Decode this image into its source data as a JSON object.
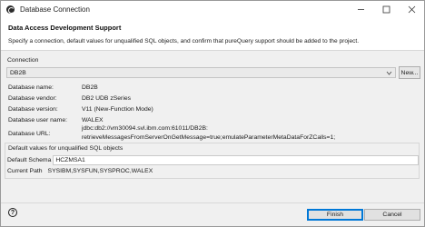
{
  "window": {
    "title": "Database Connection",
    "controls": [
      "minimize-icon",
      "maximize-icon",
      "close-icon"
    ]
  },
  "header": {
    "title": "Data Access Development Support",
    "description": "Specify a connection, default values for unqualified SQL objects, and confirm that pureQuery support should be added to the project."
  },
  "connection": {
    "label": "Connection",
    "selected": "DB2B",
    "new_label": "New..."
  },
  "details": [
    {
      "label": "Database name:",
      "value": "DB2B"
    },
    {
      "label": "Database vendor:",
      "value": "DB2 UDB zSeries"
    },
    {
      "label": "Database version:",
      "value": "V11 (New-Function Mode)"
    },
    {
      "label": "Database user name:",
      "value": "WALEX"
    },
    {
      "label": "Database URL:",
      "value": "jdbc:db2://vm30094.svl.ibm.com:61011/DB2B:",
      "value2": "retrieveMessagesFromServerOnGetMessage=true;emulateParameterMetaDataForZCalls=1;"
    }
  ],
  "defaults": {
    "group_title": "Default values for unqualified SQL objects",
    "schema_label": "Default Schema",
    "schema_value": "HCZMSA1",
    "path_label": "Current Path",
    "path_value": "SYSIBM,SYSFUN,SYSPROC,WALEX"
  },
  "footer": {
    "help_symbol": "?",
    "finish_label": "Finish",
    "cancel_label": "Cancel"
  },
  "colors": {
    "accent": "#0078d7",
    "background": "#f0f0f0",
    "header_bg": "#ffffff"
  }
}
